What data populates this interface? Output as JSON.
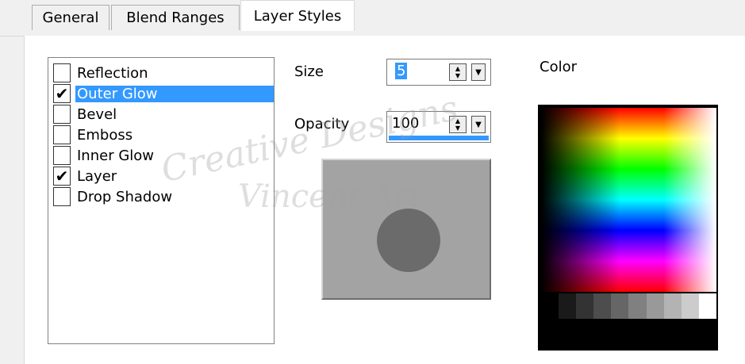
{
  "tabs": [
    {
      "label": "General",
      "active": false
    },
    {
      "label": "Blend Ranges",
      "active": false
    },
    {
      "label": "Layer Styles",
      "active": true
    }
  ],
  "styles_list": [
    {
      "label": "Reflection",
      "checked": false,
      "selected": false
    },
    {
      "label": "Outer Glow",
      "checked": true,
      "selected": true
    },
    {
      "label": "Bevel",
      "checked": false,
      "selected": false
    },
    {
      "label": "Emboss",
      "checked": false,
      "selected": false
    },
    {
      "label": "Inner Glow",
      "checked": false,
      "selected": false
    },
    {
      "label": "Layer",
      "checked": true,
      "selected": false
    },
    {
      "label": "Drop Shadow",
      "checked": false,
      "selected": false
    }
  ],
  "size": {
    "label": "Size",
    "value": "5"
  },
  "opacity": {
    "label": "Opacity",
    "value": "100"
  },
  "color": {
    "label": "Color"
  },
  "watermark": {
    "line1": "Creative Designs",
    "line2": "Vincent Art"
  },
  "colors": {
    "selection": "#3399ff",
    "preview_bg": "#a3a3a3",
    "preview_dot": "#6b6b6b"
  }
}
